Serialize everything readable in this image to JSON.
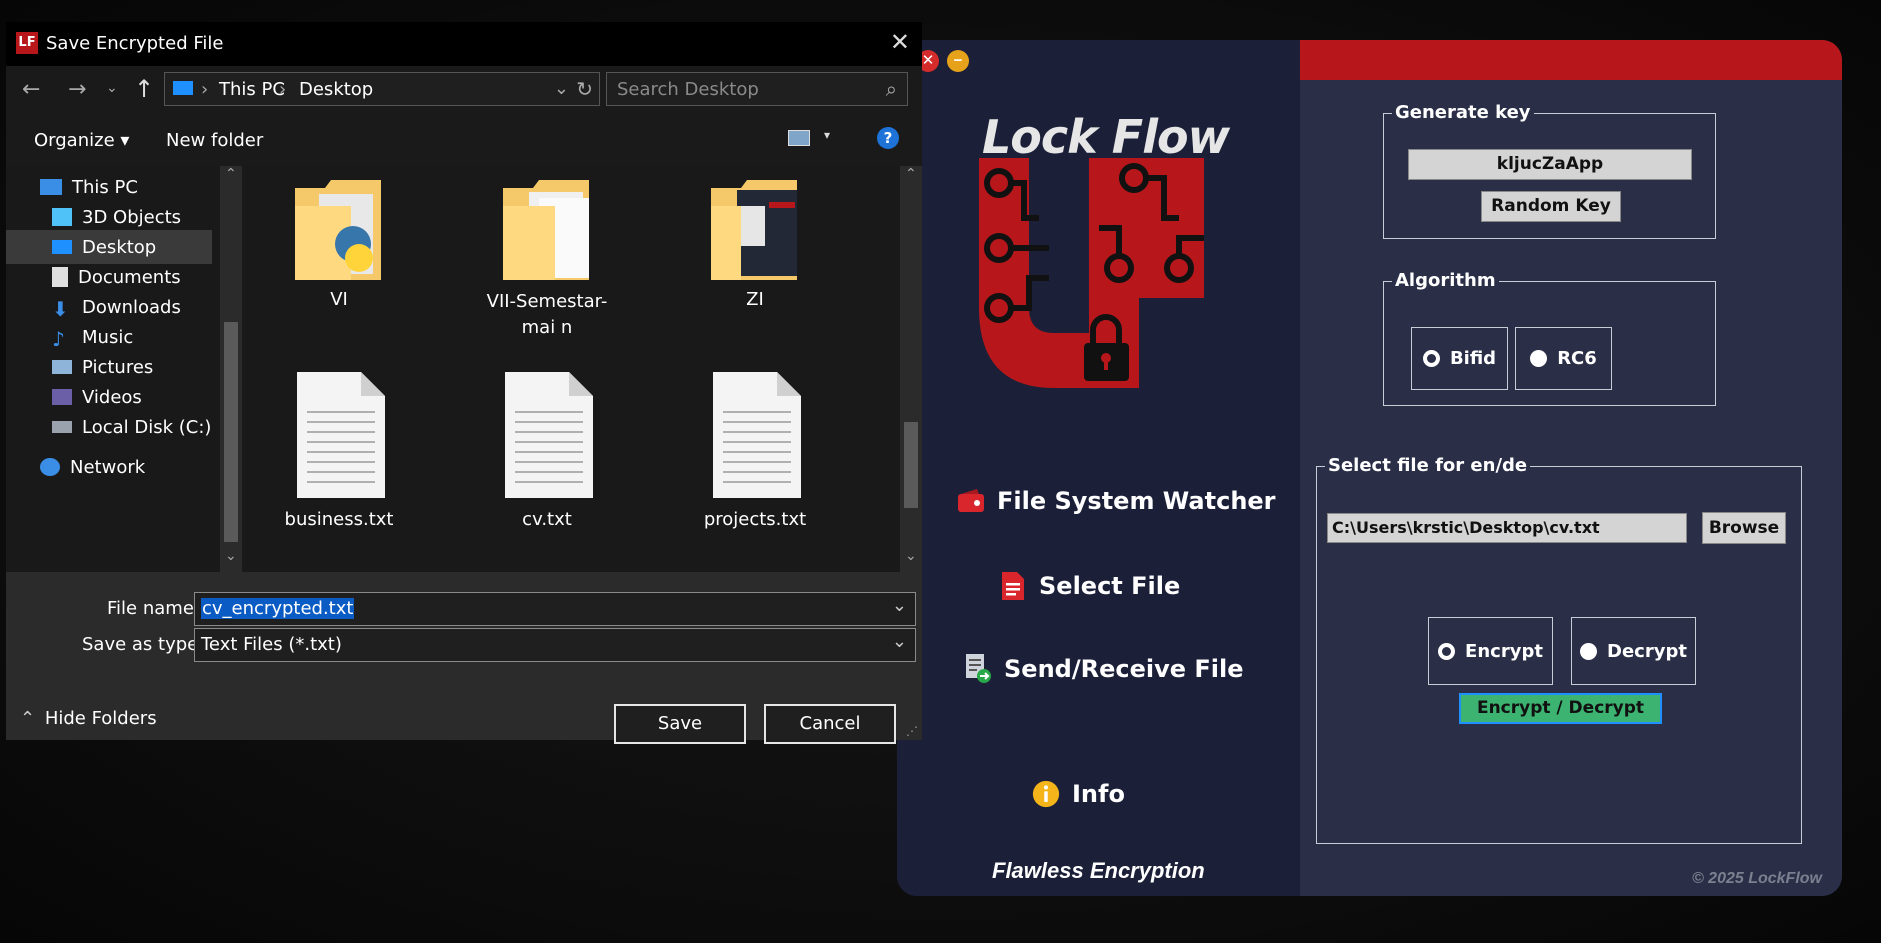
{
  "app": {
    "logo_text": "Lock Flow",
    "nav": [
      {
        "label": "File System Watcher",
        "icon": "wallet-icon"
      },
      {
        "label": "Select File",
        "icon": "document-icon"
      },
      {
        "label": "Send/Receive File",
        "icon": "file-transfer-icon"
      },
      {
        "label": "Info",
        "icon": "info-icon"
      }
    ],
    "tagline": "Flawless Encryption",
    "copyright": "© 2025 LockFlow",
    "generate_key": {
      "title": "Generate key",
      "key_value": "kljucZaApp",
      "random_key_label": "Random Key"
    },
    "algorithm": {
      "title": "Algorithm",
      "options": [
        "Bifid",
        "RC6"
      ],
      "selected": "Bifid"
    },
    "file_section": {
      "title": "Select file for en/de",
      "path": "C:\\Users\\krstic\\Desktop\\cv.txt",
      "browse_label": "Browse",
      "modes": [
        "Encrypt",
        "Decrypt"
      ],
      "selected_mode": "Encrypt",
      "action_label": "Encrypt / Decrypt"
    },
    "colors": {
      "accent_red": "#b7171b",
      "action_green": "#3cb371"
    }
  },
  "dialog": {
    "title": "Save Encrypted File",
    "breadcrumb": [
      "This PC",
      "Desktop"
    ],
    "search_placeholder": "Search Desktop",
    "organize_label": "Organize",
    "new_folder_label": "New folder",
    "nav_items": [
      {
        "label": "This PC",
        "icon": "computer-icon"
      },
      {
        "label": "3D Objects",
        "icon": "cube-icon"
      },
      {
        "label": "Desktop",
        "icon": "desktop-icon",
        "selected": true
      },
      {
        "label": "Documents",
        "icon": "document-icon"
      },
      {
        "label": "Downloads",
        "icon": "download-icon"
      },
      {
        "label": "Music",
        "icon": "music-icon"
      },
      {
        "label": "Pictures",
        "icon": "picture-icon"
      },
      {
        "label": "Videos",
        "icon": "video-icon"
      },
      {
        "label": "Local Disk (C:)",
        "icon": "disk-icon"
      },
      {
        "label": "Network",
        "icon": "network-icon"
      }
    ],
    "files": [
      {
        "name": "VI",
        "type": "folder"
      },
      {
        "name": "VII-Semestar-mai n",
        "type": "folder"
      },
      {
        "name": "ZI",
        "type": "folder"
      },
      {
        "name": "business.txt",
        "type": "text"
      },
      {
        "name": "cv.txt",
        "type": "text"
      },
      {
        "name": "projects.txt",
        "type": "text"
      }
    ],
    "file_name_label": "File name:",
    "file_name_value": "cv_encrypted.txt",
    "save_type_label": "Save as type:",
    "save_type_value": "Text Files (*.txt)",
    "hide_folders_label": "Hide Folders",
    "save_label": "Save",
    "cancel_label": "Cancel"
  }
}
